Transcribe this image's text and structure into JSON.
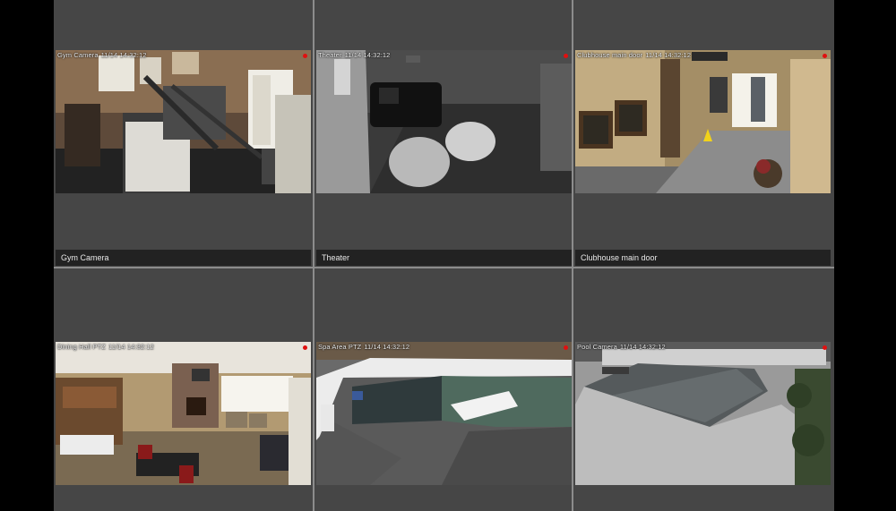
{
  "timestamp": "11/14 14:32:12",
  "colors": {
    "background": "#000000",
    "tile": "#464646",
    "label_bar": "#222222",
    "recording_dot": "#e01010"
  },
  "cameras": [
    {
      "name": "Gym Camera",
      "overlay_name": "Gym Camera",
      "label": "Gym Camera",
      "recording": true
    },
    {
      "name": "Theater",
      "overlay_name": "Theater",
      "label": "Theater",
      "recording": true
    },
    {
      "name": "Clubhouse main door",
      "overlay_name": "Clubhouse main door",
      "label": "Clubhouse main door",
      "recording": true
    },
    {
      "name": "Dining Hall PTZ",
      "overlay_name": "Dining Hall PTZ",
      "label": "",
      "recording": true
    },
    {
      "name": "Spa Area PTZ",
      "overlay_name": "Spa Area PTZ",
      "label": "",
      "recording": true
    },
    {
      "name": "Pool Camera",
      "overlay_name": "Pool Camera",
      "label": "",
      "recording": true
    }
  ]
}
